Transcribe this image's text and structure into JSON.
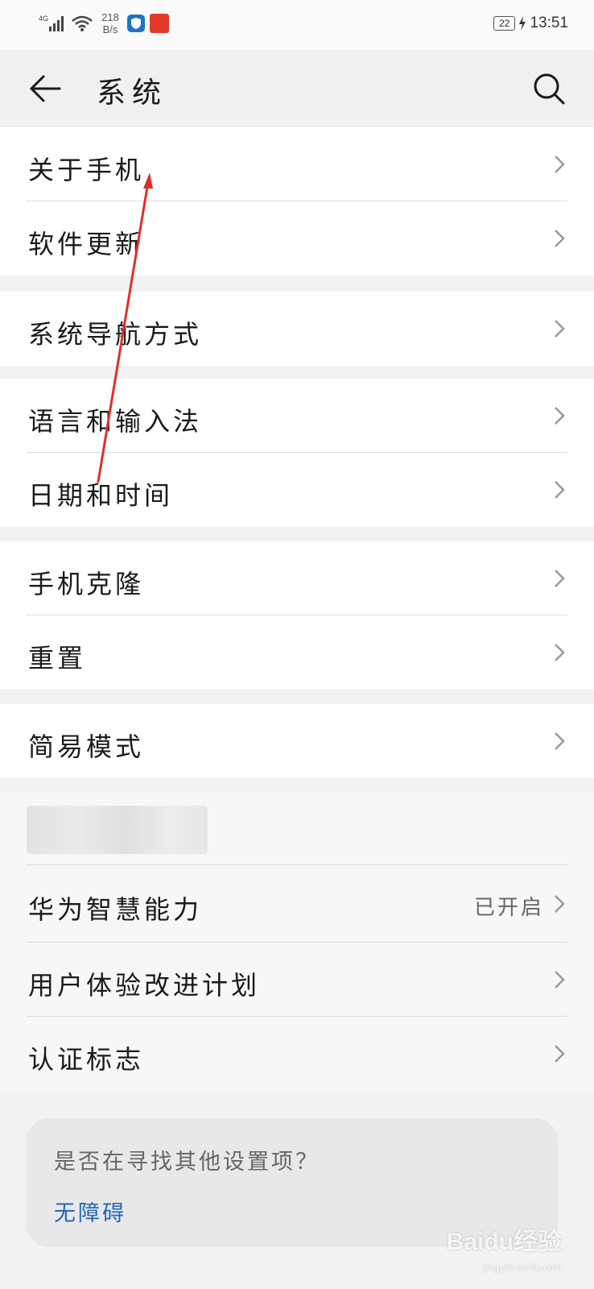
{
  "status_bar": {
    "network": "4G",
    "speed_value": "218",
    "speed_unit": "B/s",
    "battery": "22",
    "time": "13:51"
  },
  "header": {
    "title": "系统",
    "back_icon": "back-arrow-icon",
    "search_icon": "search-icon"
  },
  "groups": [
    {
      "items": [
        {
          "label": "关于手机"
        },
        {
          "label": "软件更新"
        }
      ]
    },
    {
      "items": [
        {
          "label": "系统导航方式"
        }
      ]
    },
    {
      "items": [
        {
          "label": "语言和输入法"
        },
        {
          "label": "日期和时间"
        }
      ]
    },
    {
      "items": [
        {
          "label": "手机克隆"
        },
        {
          "label": "重置"
        }
      ]
    },
    {
      "items": [
        {
          "label": "简易模式"
        }
      ]
    },
    {
      "items": [
        {
          "label": ""
        },
        {
          "label": "华为智慧能力",
          "value": "已开启"
        },
        {
          "label": "用户体验改进计划"
        },
        {
          "label": "认证标志"
        }
      ]
    }
  ],
  "suggestion": {
    "title": "是否在寻找其他设置项？",
    "link": "无障碍"
  },
  "watermark": {
    "brand": "Baidu经验",
    "domain": "jingyan.baidu.com"
  },
  "colors": {
    "background": "#f2f2f2",
    "link": "#2366b8",
    "annotation_arrow": "#e0302a"
  }
}
